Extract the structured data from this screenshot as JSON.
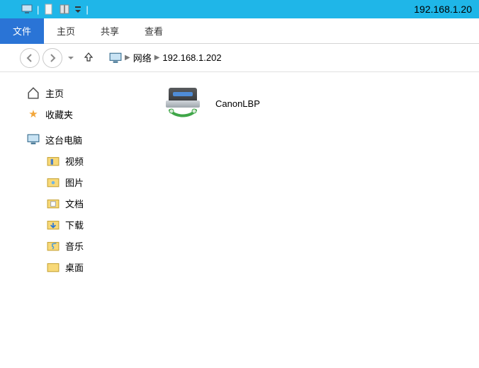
{
  "title": "192.168.1.20",
  "ribbon": {
    "file": "文件",
    "home": "主页",
    "share": "共享",
    "view": "查看"
  },
  "breadcrumb": {
    "root": "网络",
    "leaf": "192.168.1.202"
  },
  "sidebar": {
    "home": "主页",
    "favorites": "收藏夹",
    "thispc": "这台电脑",
    "children": {
      "videos": "视频",
      "pictures": "图片",
      "documents": "文档",
      "downloads": "下载",
      "music": "音乐",
      "desktop": "桌面"
    }
  },
  "main": {
    "printer_name": "CanonLBP"
  }
}
